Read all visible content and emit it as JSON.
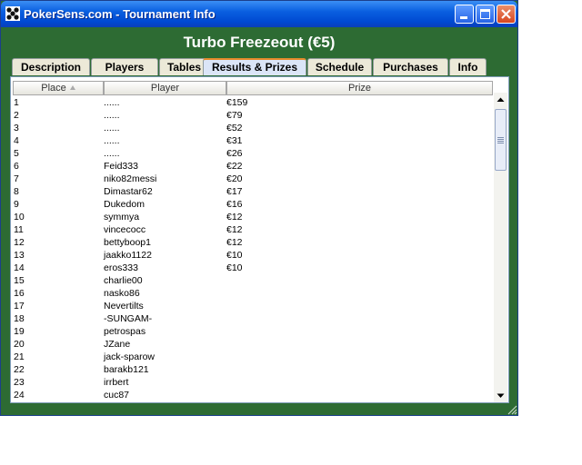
{
  "window": {
    "title": "PokerSens.com - Tournament Info",
    "buttons": {
      "minimize": "minimize",
      "maximize": "maximize",
      "close": "close"
    }
  },
  "tournament": {
    "name": "Turbo Freezeout (€5)"
  },
  "tabs": [
    {
      "label": "Description"
    },
    {
      "label": "Players"
    },
    {
      "label": "Tables"
    },
    {
      "label": "Results & Prizes",
      "active": true
    },
    {
      "label": "Schedule"
    },
    {
      "label": "Purchases"
    },
    {
      "label": "Info"
    }
  ],
  "table": {
    "columns": [
      "Place",
      "Player",
      "Prize"
    ],
    "sorted_by": "Place",
    "rows": [
      {
        "place": "1",
        "player": "......",
        "prize": "€159"
      },
      {
        "place": "2",
        "player": "......",
        "prize": "€79"
      },
      {
        "place": "3",
        "player": "......",
        "prize": "€52"
      },
      {
        "place": "4",
        "player": "......",
        "prize": "€31"
      },
      {
        "place": "5",
        "player": "......",
        "prize": "€26"
      },
      {
        "place": "6",
        "player": "Feid333",
        "prize": "€22"
      },
      {
        "place": "7",
        "player": "niko82messi",
        "prize": "€20"
      },
      {
        "place": "8",
        "player": "Dimastar62",
        "prize": "€17"
      },
      {
        "place": "9",
        "player": "Dukedom",
        "prize": "€16"
      },
      {
        "place": "10",
        "player": "symmya",
        "prize": "€12"
      },
      {
        "place": "11",
        "player": "vincecocc",
        "prize": "€12"
      },
      {
        "place": "12",
        "player": "bettyboop1",
        "prize": "€12"
      },
      {
        "place": "13",
        "player": "jaakko1122",
        "prize": "€10"
      },
      {
        "place": "14",
        "player": "eros333",
        "prize": "€10"
      },
      {
        "place": "15",
        "player": "charlie00",
        "prize": ""
      },
      {
        "place": "16",
        "player": "nasko86",
        "prize": ""
      },
      {
        "place": "17",
        "player": "Nevertilts",
        "prize": ""
      },
      {
        "place": "18",
        "player": "-SUNGAM-",
        "prize": ""
      },
      {
        "place": "19",
        "player": "petrospas",
        "prize": ""
      },
      {
        "place": "20",
        "player": "JZane",
        "prize": ""
      },
      {
        "place": "21",
        "player": "jack-sparow",
        "prize": ""
      },
      {
        "place": "22",
        "player": "barakb121",
        "prize": ""
      },
      {
        "place": "23",
        "player": "irrbert",
        "prize": ""
      },
      {
        "place": "24",
        "player": "cuc87",
        "prize": ""
      }
    ]
  },
  "colors": {
    "window_bg": "#2d6b33",
    "titlebar": "#0a5fe0",
    "active_tab_accent": "#e68b2c"
  },
  "icons": [
    "app-icon",
    "minimize-icon",
    "maximize-icon",
    "close-icon",
    "sort-ascending-icon",
    "scroll-up-icon",
    "scroll-down-icon",
    "resize-grip-icon"
  ]
}
